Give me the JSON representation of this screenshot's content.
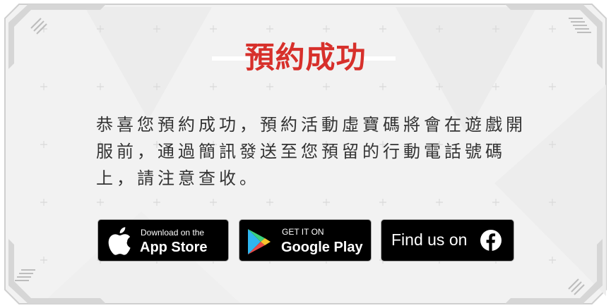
{
  "dialog": {
    "title": "預約成功",
    "message_lines": [
      "恭喜您預約成功，預約活動虛寶碼將會在遊戲開",
      "服前，通過簡訊發送至您預留的行動電話號碼",
      "上，請注意查收。"
    ]
  },
  "buttons": {
    "app_store": {
      "small": "Download on the",
      "big": "App Store",
      "icon": "apple-icon"
    },
    "google_play": {
      "small": "GET IT ON",
      "big": "Google Play",
      "icon": "google-play-icon"
    },
    "facebook": {
      "label": "Find us on",
      "icon": "facebook-icon"
    }
  },
  "colors": {
    "title": "#d7302b",
    "text": "#333333",
    "button_bg": "#000000"
  }
}
